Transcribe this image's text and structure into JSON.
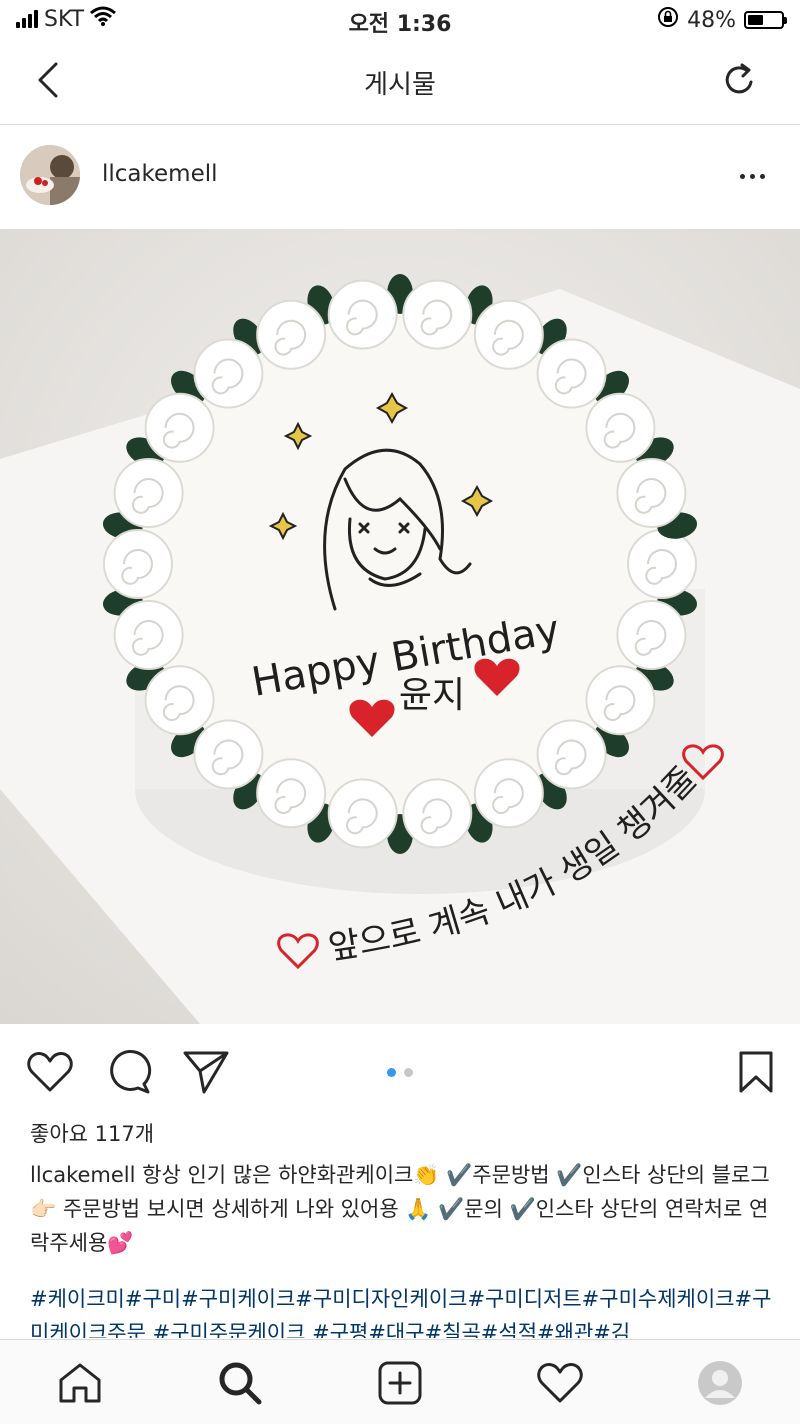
{
  "status_bar": {
    "carrier": "SKT",
    "time": "오전 1:36",
    "battery": "48%",
    "battery_level": 0.48
  },
  "nav": {
    "title": "게시물"
  },
  "post": {
    "username": "llcakemell",
    "photo": {
      "cake_text_top": "Happy Birthday",
      "cake_text_name": "윤지",
      "board_text": "앞으로 계속 내가 생일 챙겨줄게"
    },
    "carousel": {
      "count": 2,
      "active": 1
    },
    "likes": "좋아요 117개",
    "caption_user": "llcakemell",
    "caption_text": "항상 인기 많은 하얀화관케이크👏 ✔️주문방법 ✔️인스타 상단의 블로그 👉🏻 주문방법 보시면 상세하게 나와 있어용 🙏 ✔️문의 ✔️인스타 상단의 연락처로 연락주세용💕",
    "hashtags": "#케이크미#구미#구미케이크#구미디자인케이크#구미디저트#구미수제케이크#구미케이크주문 #구미주문케이크 #구평#대구#칠곡#석적#왜관#김"
  },
  "colors": {
    "hashtag": "#003569",
    "carousel_active": "#3897f0",
    "heart_red": "#d8232a",
    "leaf_green": "#1e3d2a"
  }
}
